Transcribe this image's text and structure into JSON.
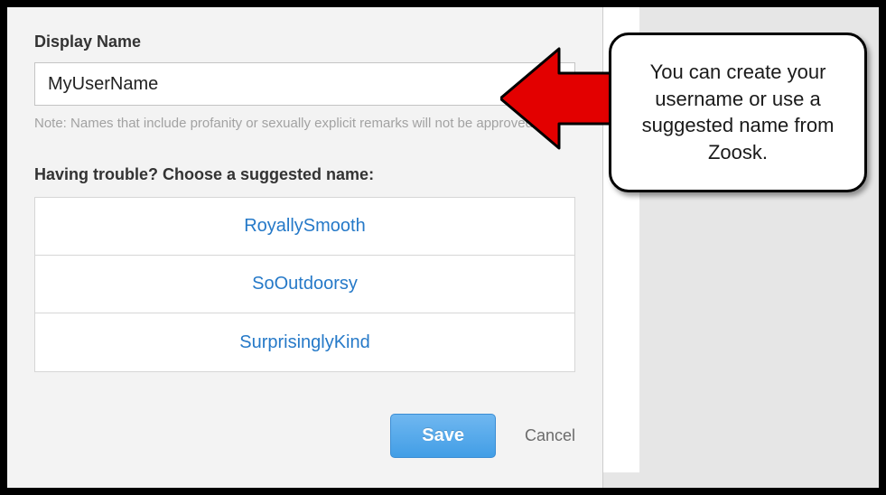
{
  "form": {
    "display_name_label": "Display Name",
    "display_name_value": "MyUserName",
    "note": "Note: Names that include profanity or sexually explicit remarks will not be approved.",
    "suggested_label": "Having trouble? Choose a suggested name:",
    "suggestions": [
      "RoyallySmooth",
      "SoOutdoorsy",
      "SurprisinglyKind"
    ],
    "save_label": "Save",
    "cancel_label": "Cancel"
  },
  "callout": {
    "text": "You can create your username or use a suggested name from Zoosk."
  },
  "colors": {
    "link": "#2579c8",
    "arrow": "#e30000"
  }
}
